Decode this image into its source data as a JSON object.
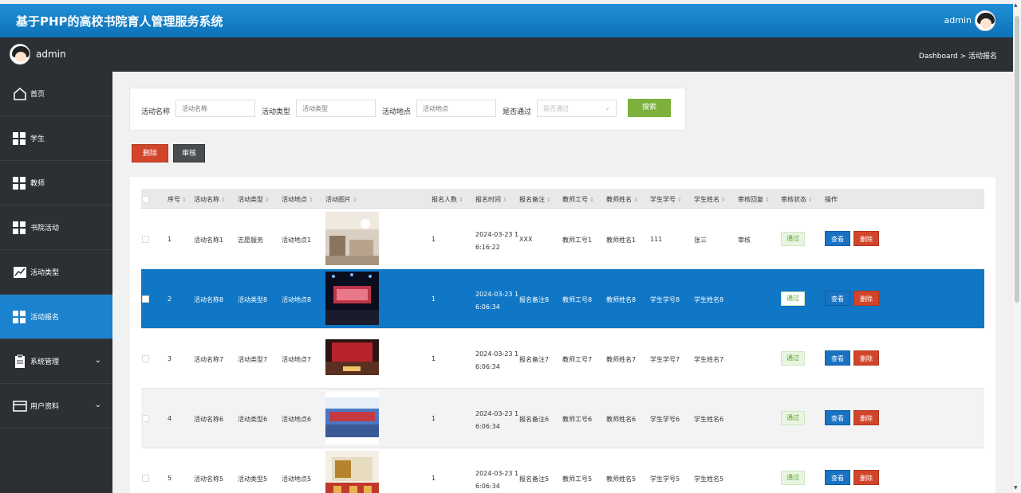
{
  "header": {
    "title": "基于PHP的高校书院育人管理服务系统",
    "user": "admin"
  },
  "subbar": {
    "name": "admin",
    "breadcrumb": "Dashboard > 活动报名"
  },
  "sidebar": {
    "items": [
      {
        "label": "首页",
        "icon": "home-icon"
      },
      {
        "label": "学生",
        "icon": "grid-icon"
      },
      {
        "label": "教师",
        "icon": "grid-icon"
      },
      {
        "label": "书院活动",
        "icon": "grid-icon"
      },
      {
        "label": "活动类型",
        "icon": "chart-icon"
      },
      {
        "label": "活动报名",
        "icon": "grid-icon",
        "active": true
      },
      {
        "label": "系统管理",
        "icon": "clipboard-icon",
        "expandable": true
      },
      {
        "label": "用户资料",
        "icon": "card-icon",
        "expandable": true
      }
    ]
  },
  "search": {
    "name_label": "活动名称",
    "name_placeholder": "活动名称",
    "type_label": "活动类型",
    "type_placeholder": "活动类型",
    "place_label": "活动地点",
    "place_placeholder": "活动地点",
    "status_label": "是否通过",
    "status_placeholder": "是否通过",
    "button": "搜索"
  },
  "actions": {
    "delete": "删除",
    "review": "审核"
  },
  "table": {
    "headers": [
      "序号",
      "活动名称",
      "活动类型",
      "活动地点",
      "活动图片",
      "报名人数",
      "报名时间",
      "报名备注",
      "教师工号",
      "教师姓名",
      "学生学号",
      "学生姓名",
      "审核回复",
      "审核状态",
      "操作"
    ],
    "view_label": "查看",
    "delete_label": "删除",
    "rows": [
      {
        "no": "1",
        "name": "活动名称1",
        "type": "志愿服务",
        "place": "活动地点1",
        "count": "1",
        "time1": "2024-03-23 1",
        "time2": "6:16:22",
        "remark": "XXX",
        "tno": "教师工号1",
        "tname": "教师姓名1",
        "sno": "111",
        "sname": "张三",
        "reply": "审核",
        "status": "通过"
      },
      {
        "no": "2",
        "name": "活动名称8",
        "type": "活动类型8",
        "place": "活动地点8",
        "count": "1",
        "time1": "2024-03-23 1",
        "time2": "6:06:34",
        "remark": "报名备注8",
        "tno": "教师工号8",
        "tname": "教师姓名8",
        "sno": "学生学号8",
        "sname": "学生姓名8",
        "reply": "",
        "status": "通过"
      },
      {
        "no": "3",
        "name": "活动名称7",
        "type": "活动类型7",
        "place": "活动地点7",
        "count": "1",
        "time1": "2024-03-23 1",
        "time2": "6:06:34",
        "remark": "报名备注7",
        "tno": "教师工号7",
        "tname": "教师姓名7",
        "sno": "学生学号7",
        "sname": "学生姓名7",
        "reply": "",
        "status": "通过"
      },
      {
        "no": "4",
        "name": "活动名称6",
        "type": "活动类型6",
        "place": "活动地点6",
        "count": "1",
        "time1": "2024-03-23 1",
        "time2": "6:06:34",
        "remark": "报名备注6",
        "tno": "教师工号6",
        "tname": "教师姓名6",
        "sno": "学生学号6",
        "sname": "学生姓名6",
        "reply": "",
        "status": "通过"
      },
      {
        "no": "5",
        "name": "活动名称5",
        "type": "活动类型5",
        "place": "活动地点5",
        "count": "1",
        "time1": "2024-03-23 1",
        "time2": "6:06:34",
        "remark": "报名备注5",
        "tno": "教师工号5",
        "tname": "教师姓名5",
        "sno": "学生学号5",
        "sname": "学生姓名5",
        "reply": "",
        "status": "通过"
      }
    ]
  }
}
